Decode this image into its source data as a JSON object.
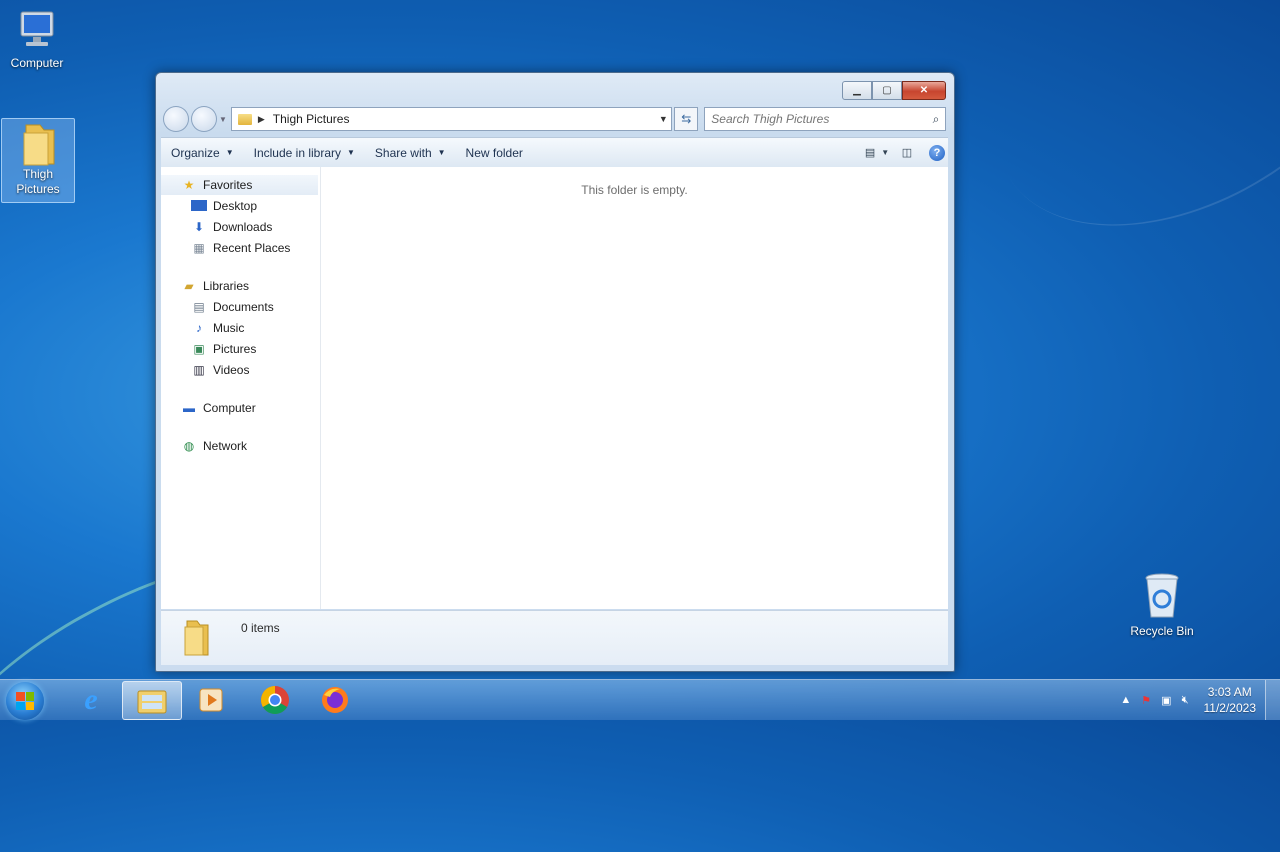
{
  "desktop": {
    "icons": [
      {
        "label": "Computer"
      },
      {
        "label": "Thigh Pictures"
      },
      {
        "label": "Recycle Bin"
      }
    ]
  },
  "window": {
    "address": {
      "path": "Thigh Pictures"
    },
    "search": {
      "placeholder": "Search Thigh Pictures"
    },
    "toolbar": {
      "organize": "Organize",
      "include_in_library": "Include in library",
      "share_with": "Share with",
      "new_folder": "New folder"
    },
    "nav": {
      "favorites": {
        "label": "Favorites",
        "items": [
          "Desktop",
          "Downloads",
          "Recent Places"
        ]
      },
      "libraries": {
        "label": "Libraries",
        "items": [
          "Documents",
          "Music",
          "Pictures",
          "Videos"
        ]
      },
      "computer": "Computer",
      "network": "Network"
    },
    "empty_message": "This folder is empty.",
    "details": {
      "items_count": "0 items"
    }
  },
  "taskbar": {
    "clock": {
      "time": "3:03 AM",
      "date": "11/2/2023"
    }
  },
  "colors": {
    "accent": "#1a78cf",
    "close": "#c7452f"
  }
}
